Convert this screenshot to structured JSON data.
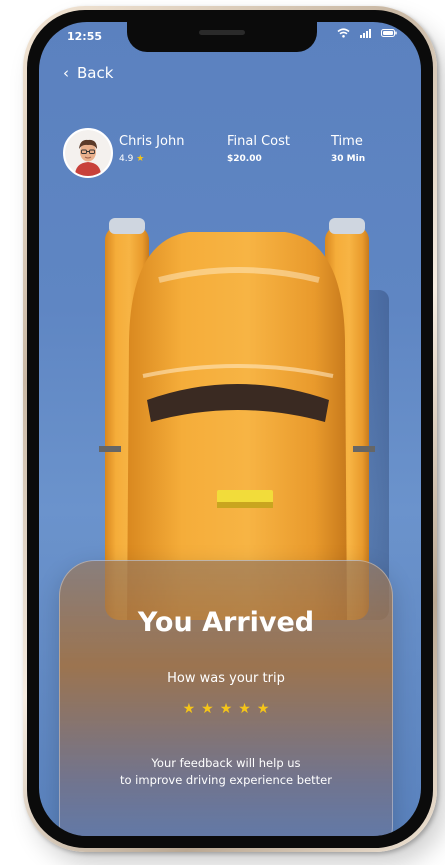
{
  "status_bar": {
    "time": "12:55"
  },
  "nav": {
    "back_label": "Back"
  },
  "driver": {
    "name": "Chris John",
    "rating": "4.9"
  },
  "trip": {
    "final_cost_label": "Final Cost",
    "final_cost_value": "$20.00",
    "time_label": "Time",
    "time_value": "30 Min"
  },
  "arrival_card": {
    "title": "You Arrived",
    "question": "How was your trip",
    "stars": 5,
    "feedback_line1": "Your feedback will help us",
    "feedback_line2": "to improve driving experience better"
  },
  "colors": {
    "screen_bg": "#5f86c3",
    "taxi_yellow": "#f0a330",
    "star": "#f5c518"
  }
}
